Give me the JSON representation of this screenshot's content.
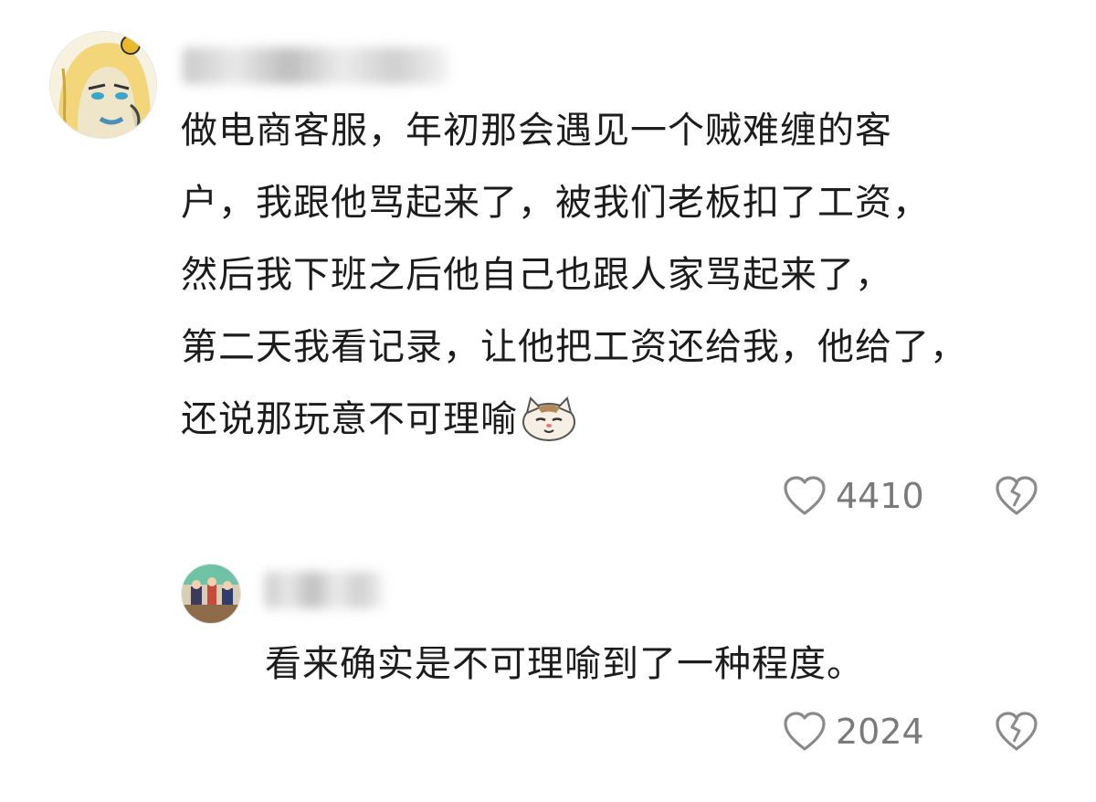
{
  "comments": [
    {
      "text": "做电商客服，年初那会遇见一个贼难缠的客户，我跟他骂起来了，被我们老板扣了工资，然后我下班之后他自己也跟人家骂起来了，第二天我看记录，让他把工资还给我，他给了，还说那玩意不可理喻",
      "lines": [
        "做电商客服，年初那会遇见一个贼难缠的客",
        "户，我跟他骂起来了，被我们老板扣了工资，",
        "然后我下班之后他自己也跟人家骂起来了，",
        "第二天我看记录，让他把工资还给我，他给了，",
        "还说那玩意不可理喻"
      ],
      "emoji": "cat-emoji",
      "likes": "4410",
      "like_icon": "heart-outline-icon",
      "dislike_icon": "broken-heart-icon"
    },
    {
      "text": "看来确实是不可理喻到了一种程度。",
      "lines": [
        "看来确实是不可理喻到了一种程度。"
      ],
      "likes": "2024",
      "like_icon": "heart-outline-icon",
      "dislike_icon": "broken-heart-icon"
    }
  ],
  "colors": {
    "text": "#1c1c1c",
    "meta": "#7a7a7a",
    "background": "#ffffff"
  }
}
